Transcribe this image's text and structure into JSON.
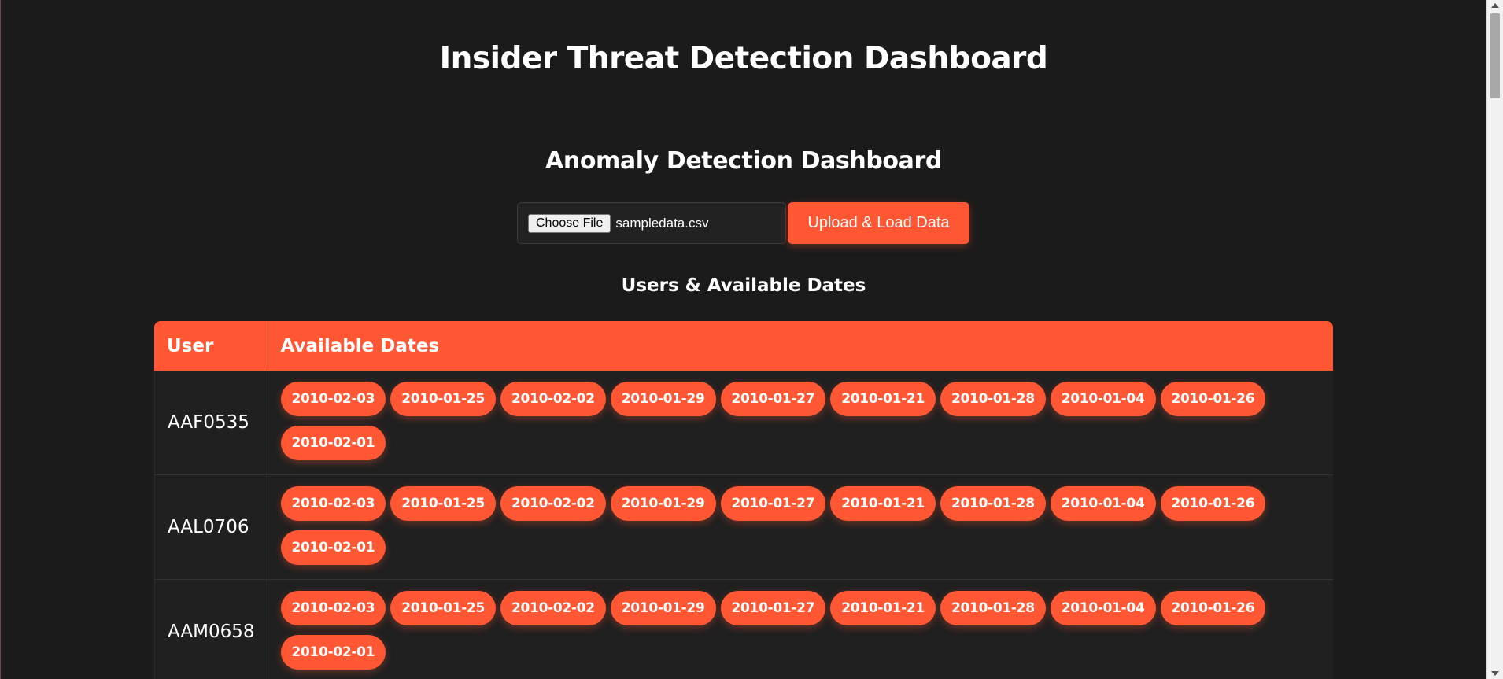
{
  "header": {
    "title": "Insider Threat Detection Dashboard"
  },
  "dashboard": {
    "subtitle": "Anomaly Detection Dashboard"
  },
  "upload": {
    "choose_file_label": "Choose File",
    "file_name": "sampledata.csv",
    "upload_button_label": "Upload & Load Data"
  },
  "users_table": {
    "section_title": "Users & Available Dates",
    "columns": [
      "User",
      "Available Dates"
    ],
    "rows": [
      {
        "user": "AAF0535",
        "dates": [
          "2010-02-03",
          "2010-01-25",
          "2010-02-02",
          "2010-01-29",
          "2010-01-27",
          "2010-01-21",
          "2010-01-28",
          "2010-01-04",
          "2010-01-26",
          "2010-02-01"
        ]
      },
      {
        "user": "AAL0706",
        "dates": [
          "2010-02-03",
          "2010-01-25",
          "2010-02-02",
          "2010-01-29",
          "2010-01-27",
          "2010-01-21",
          "2010-01-28",
          "2010-01-04",
          "2010-01-26",
          "2010-02-01"
        ]
      },
      {
        "user": "AAM0658",
        "dates": [
          "2010-02-03",
          "2010-01-25",
          "2010-02-02",
          "2010-01-29",
          "2010-01-27",
          "2010-01-21",
          "2010-01-28",
          "2010-01-04",
          "2010-01-26",
          "2010-02-01"
        ]
      }
    ]
  },
  "colors": {
    "background": "#1b1b1b",
    "accent": "#ff5733",
    "row_background": "#202020"
  }
}
